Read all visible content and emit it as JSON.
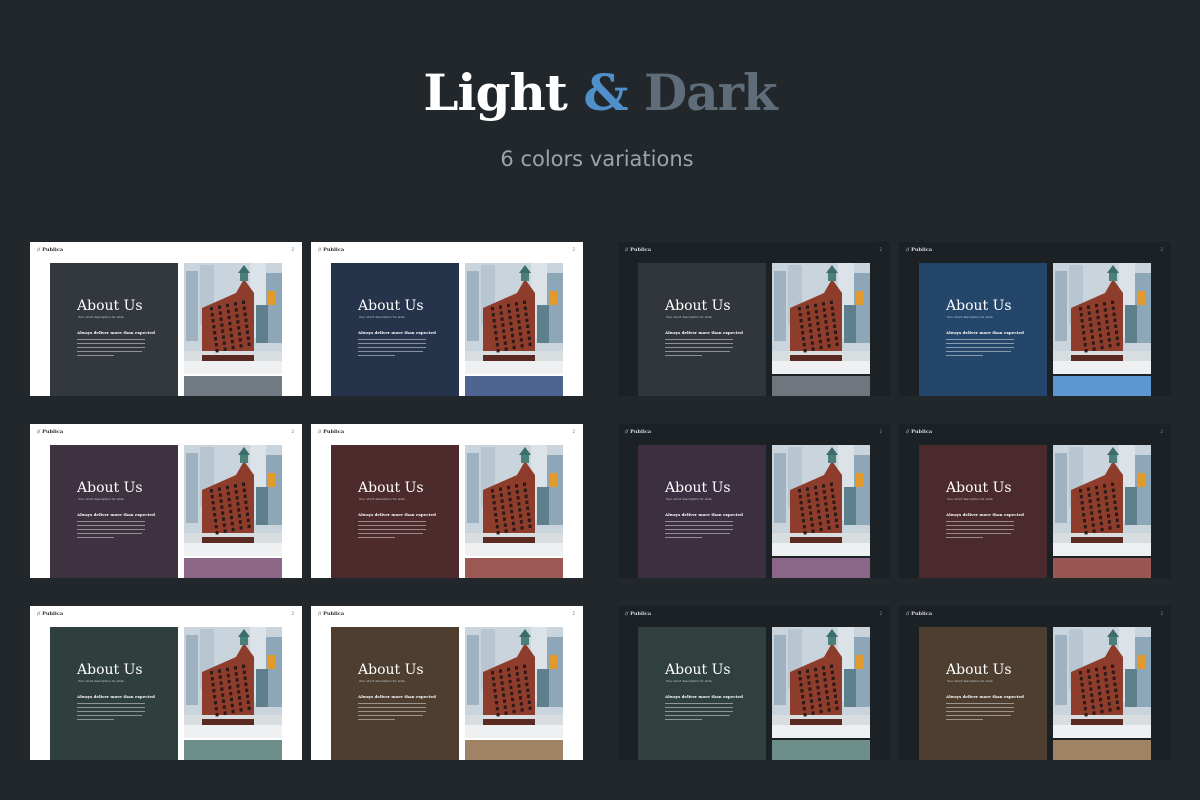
{
  "header": {
    "title_part1": "Light",
    "title_part2": "&",
    "title_part3": "Dark",
    "subtitle": "6 colors variations"
  },
  "colors": {
    "background": "#21272b",
    "title_light": "#ffffff",
    "title_amp": "#4f8fca",
    "title_dark": "#5f6d7b"
  },
  "slide_text": {
    "brand": "Publica",
    "brand_mark": "//",
    "title": "About Us",
    "subtitle": "Your short description for slide",
    "heading": "Always deliver more than expected"
  },
  "slides": [
    {
      "theme": "light",
      "page": "2",
      "panel_color": "#33383e",
      "swatch_color": "#727a84"
    },
    {
      "theme": "light",
      "page": "2",
      "panel_color": "#25344b",
      "swatch_color": "#4d6590"
    },
    {
      "theme": "dark",
      "page": "2",
      "panel_color": "#31363c",
      "swatch_color": "#6f767e"
    },
    {
      "theme": "dark",
      "page": "2",
      "panel_color": "#25466b",
      "swatch_color": "#5c97d1"
    },
    {
      "theme": "light",
      "page": "2",
      "panel_color": "#3e3140",
      "swatch_color": "#8c6686"
    },
    {
      "theme": "light",
      "page": "2",
      "panel_color": "#4d2a2c",
      "swatch_color": "#9c5853"
    },
    {
      "theme": "dark",
      "page": "2",
      "panel_color": "#3c3040",
      "swatch_color": "#8a6688"
    },
    {
      "theme": "dark",
      "page": "2",
      "panel_color": "#4a2a2c",
      "swatch_color": "#9a5752"
    },
    {
      "theme": "light",
      "page": "2",
      "panel_color": "#2f3f3e",
      "swatch_color": "#6e8f89"
    },
    {
      "theme": "light",
      "page": "2",
      "panel_color": "#4d3e2f",
      "swatch_color": "#a08264"
    },
    {
      "theme": "dark",
      "page": "2",
      "panel_color": "#2f403e",
      "swatch_color": "#6e8f89"
    },
    {
      "theme": "dark",
      "page": "2",
      "panel_color": "#4d3e2f",
      "swatch_color": "#a08264"
    }
  ]
}
